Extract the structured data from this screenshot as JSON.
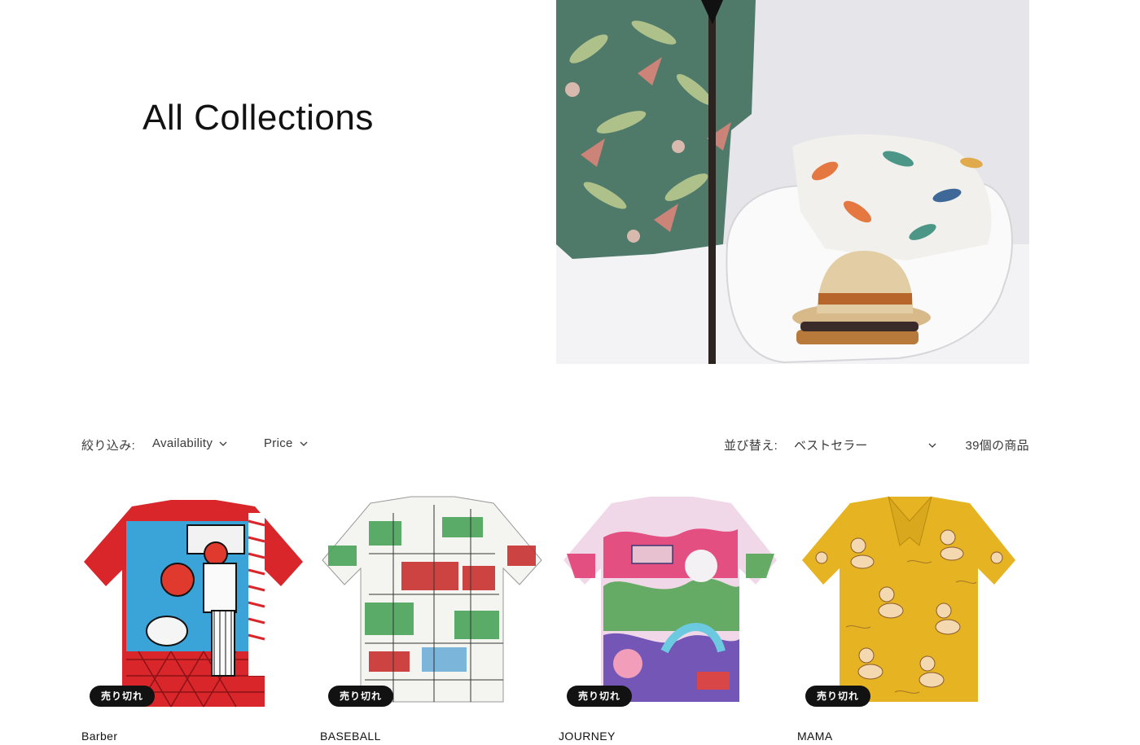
{
  "collection": {
    "title": "All Collections",
    "hero_image": "collection-banner-aloha-shirts"
  },
  "facets": {
    "filter_label": "絞り込み:",
    "filters": [
      {
        "label": "Availability"
      },
      {
        "label": "Price"
      }
    ],
    "sort_label": "並び替え:",
    "sort_value": "ベストセラー",
    "product_count": "39個の商品"
  },
  "products": [
    {
      "title": "Barber",
      "badge": "売り切れ",
      "image": "barber-shirt"
    },
    {
      "title": "BASEBALL",
      "badge": "売り切れ",
      "image": "baseball-shirt"
    },
    {
      "title": "JOURNEY",
      "badge": "売り切れ",
      "image": "journey-shirt"
    },
    {
      "title": "MAMA",
      "badge": "売り切れ",
      "image": "mama-shirt"
    }
  ],
  "colors": {
    "text": "#121212",
    "badge_bg": "#121212",
    "badge_text": "#ffffff"
  }
}
